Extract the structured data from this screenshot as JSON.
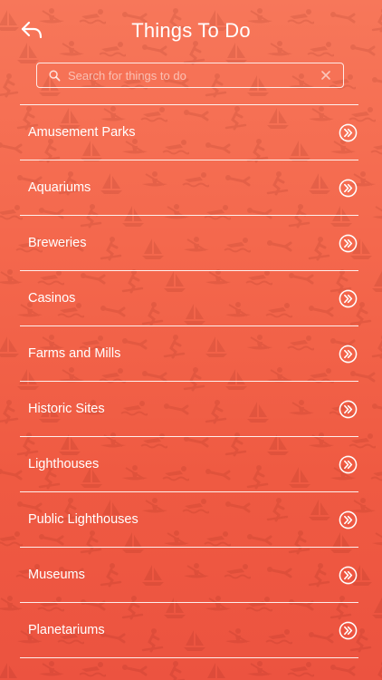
{
  "header": {
    "title": "Things To Do",
    "back_icon": "back-arrow-icon"
  },
  "search": {
    "placeholder": "Search for things to do",
    "value": "",
    "search_icon": "search-icon",
    "clear_icon": "clear-icon"
  },
  "categories": [
    {
      "label": "Amusement Parks"
    },
    {
      "label": "Aquariums"
    },
    {
      "label": "Breweries"
    },
    {
      "label": "Casinos"
    },
    {
      "label": "Farms and Mills"
    },
    {
      "label": "Historic Sites"
    },
    {
      "label": "Lighthouses"
    },
    {
      "label": "Public Lighthouses"
    },
    {
      "label": "Museums"
    },
    {
      "label": "Planetariums"
    }
  ],
  "row_icon": "double-chevron-right-icon",
  "colors": {
    "background_top": "#f7775a",
    "background_bottom": "#ec5340",
    "foreground": "#ffffff"
  }
}
